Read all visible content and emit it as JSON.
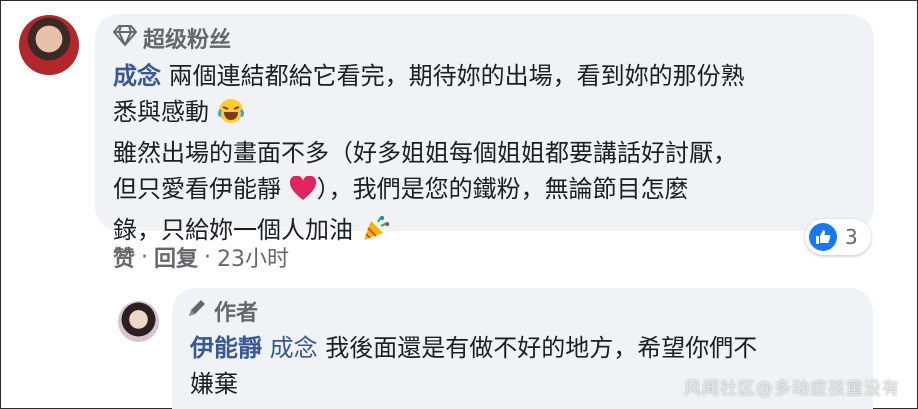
{
  "comment": {
    "badge": "超级粉丝",
    "author": "成念",
    "text_line1": "兩個連結都給它看完，期待妳的出場，看到妳的那份熟",
    "text_line2": "悉與感動",
    "text_line3": "雖然出場的畫面不多（好多姐姐每個姐姐都要講話好討厭，",
    "text_line4a": "但只愛看伊能靜",
    "text_line4b": "），我們是您的鐵粉，無論節目怎麼",
    "text_line5": "錄，只給妳一個人加油",
    "actions": {
      "like": "赞",
      "dot1": "·",
      "reply": "回复",
      "dot2": "·",
      "time": "23小时"
    },
    "reaction_count": "3"
  },
  "reply": {
    "badge": "作者",
    "author": "伊能靜",
    "mention": "成念",
    "text_line1": "我後面還是有做不好的地方，希望你們不",
    "text_line2": "嫌棄"
  },
  "watermark": "风闻社区@多动症孩童没有",
  "icons": {
    "badge1": "diamond-icon",
    "badge2": "pen-icon",
    "reaction": "like-icon"
  },
  "colors": {
    "name": "#385898",
    "bubble": "#f0f2f5",
    "like": "#1877f2"
  }
}
